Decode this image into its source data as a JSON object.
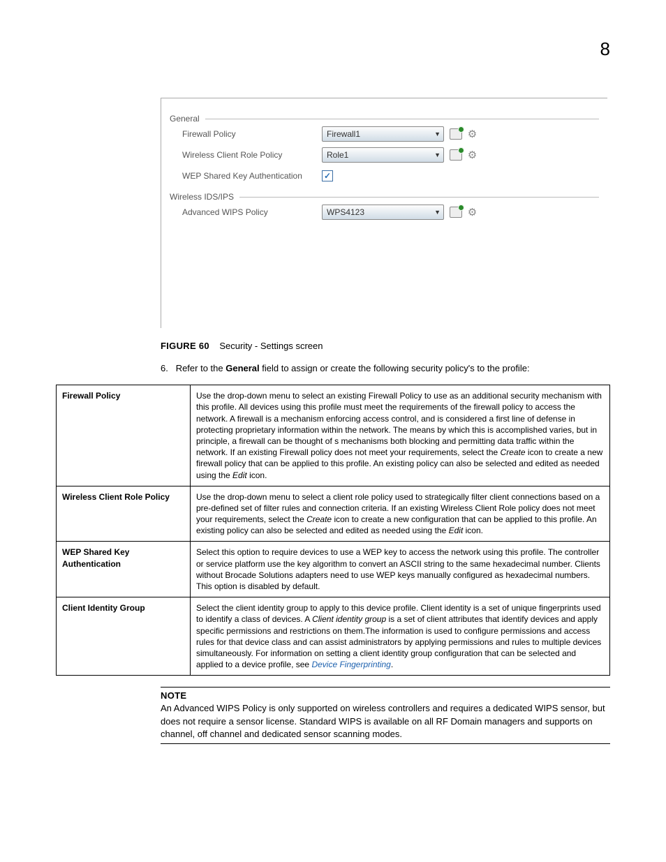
{
  "page_number": "8",
  "screenshot": {
    "sections": {
      "general": {
        "legend": "General",
        "firewall": {
          "label": "Firewall Policy",
          "value": "Firewall1"
        },
        "wcrp": {
          "label": "Wireless Client Role Policy",
          "value": "Role1"
        },
        "wep": {
          "label": "WEP Shared Key Authentication",
          "checked": true
        }
      },
      "wids": {
        "legend": "Wireless IDS/IPS",
        "wips": {
          "label": "Advanced WIPS Policy",
          "value": "WPS4123"
        }
      }
    }
  },
  "figure": {
    "label": "FIGURE 60",
    "caption": "Security - Settings screen"
  },
  "step": {
    "num": "6.",
    "lead": "Refer to the ",
    "bold": "General",
    "tail": " field to assign or create the following security policy's to the profile:"
  },
  "table": {
    "r1": {
      "h": "Firewall Policy",
      "t1": "Use the drop-down menu to select an existing Firewall Policy to use as an additional security mechanism with this profile. All devices using this profile must meet the requirements of the firewall policy to access the network. A firewall is a mechanism enforcing access control, and is considered a first line of defense in protecting proprietary information within the network. The means by which this is accomplished varies, but in principle, a firewall can be thought of s mechanisms both blocking and permitting data traffic within the network. If an existing Firewall policy does not meet your requirements, select the ",
      "i1": "Create",
      "t2": " icon to create a new firewall policy that can be applied to this profile. An existing policy can also be selected and edited as needed using the ",
      "i2": "Edit",
      "t3": " icon."
    },
    "r2": {
      "h": "Wireless Client Role Policy",
      "t1": "Use the drop-down menu to select a client role policy used to strategically filter client connections based on a pre-defined set of filter rules and connection criteria. If an existing Wireless Client Role policy does not meet your requirements, select the ",
      "i1": "Create",
      "t2": " icon to create a new configuration that can be applied to this profile. An existing policy can also be selected and edited as needed using the ",
      "i2": "Edit",
      "t3": " icon."
    },
    "r3": {
      "h": "WEP Shared Key Authentication",
      "t": "Select this option to require devices to use a WEP key to access the network using this profile. The controller or service platform use the key algorithm to convert an ASCII string to the same hexadecimal number. Clients without Brocade Solutions adapters need to use WEP keys manually configured as hexadecimal numbers. This option is disabled by default."
    },
    "r4": {
      "h": "Client Identity Group",
      "t1": "Select the client identity group to apply to this device profile. Client identity is a set of unique fingerprints used to identify a class of devices. A ",
      "i1": "Client identity group",
      "t2": " is a set of client attributes that identify devices and apply specific permissions and restrictions on them.The information is used to configure permissions and access rules for that device class and can assist administrators by applying permissions and rules to multiple devices simultaneously. For information on setting a client identity group configuration that can be selected and applied to a device profile, see ",
      "link": "Device Fingerprinting",
      "t3": "."
    }
  },
  "note": {
    "title": "NOTE",
    "body": "An Advanced WIPS Policy is only supported on wireless controllers and requires a dedicated WIPS sensor, but does not require a sensor license. Standard WIPS is available on all RF Domain managers and supports on channel, off channel and dedicated sensor scanning modes."
  }
}
